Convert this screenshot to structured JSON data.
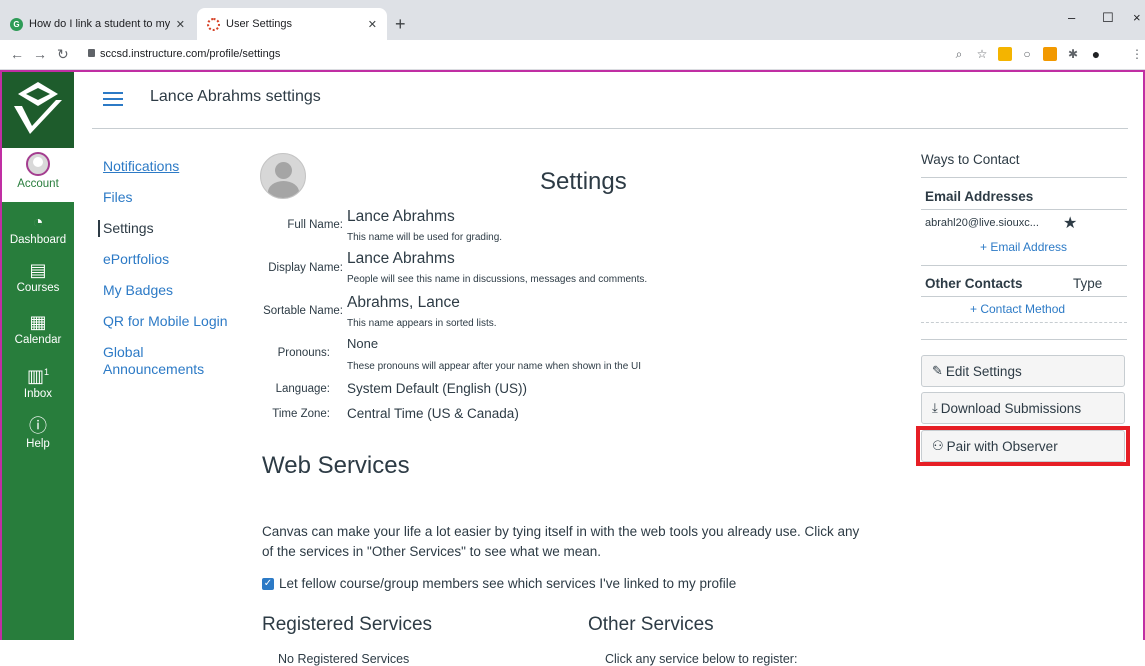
{
  "browser": {
    "tabs": [
      {
        "label": "How do I link a student to my us",
        "active": false
      },
      {
        "label": "User Settings",
        "active": true
      }
    ],
    "new_tab": "+",
    "url": "sccsd.instructure.com/profile/settings",
    "window_controls": {
      "minimize": "–",
      "maximize": "☐",
      "close": "×"
    }
  },
  "global_nav": {
    "items": [
      {
        "label": "Account",
        "icon": "user-avatar-icon"
      },
      {
        "label": "Dashboard",
        "icon": "dashboard-icon"
      },
      {
        "label": "Courses",
        "icon": "courses-icon"
      },
      {
        "label": "Calendar",
        "icon": "calendar-icon"
      },
      {
        "label": "Inbox",
        "icon": "inbox-icon",
        "badge": "1"
      },
      {
        "label": "Help",
        "icon": "help-icon"
      }
    ]
  },
  "header": {
    "name": "Lance Abrahms",
    "suffix": "settings"
  },
  "section_nav": [
    {
      "label": "Notifications"
    },
    {
      "label": "Files"
    },
    {
      "label": "Settings"
    },
    {
      "label": "ePortfolios"
    },
    {
      "label": "My Badges"
    },
    {
      "label": "QR for Mobile Login"
    },
    {
      "label": "Global\nAnnouncements"
    }
  ],
  "settings": {
    "title": "Settings",
    "fields": [
      {
        "label": "Full Name:",
        "value": "Lance Abrahms",
        "hint": "This name will be used for grading."
      },
      {
        "label": "Display Name:",
        "value": "Lance Abrahms",
        "hint": "People will see this name in discussions, messages and comments."
      },
      {
        "label": "Sortable Name:",
        "value": "Abrahms, Lance",
        "hint": "This name appears in sorted lists."
      },
      {
        "label": "Pronouns:",
        "value": "None",
        "hint": "These pronouns will appear after your name when shown in the UI"
      },
      {
        "label": "Language:",
        "value": "System Default (English (US))"
      },
      {
        "label": "Time Zone:",
        "value": "Central Time (US & Canada)"
      }
    ]
  },
  "web_services": {
    "title": "Web Services",
    "description": "Canvas can make your life a lot easier by tying itself in with the web tools you already use. Click any of the services in \"Other Services\" to see what we mean.",
    "checkbox_label": "Let fellow course/group members see which services I've linked to my profile",
    "registered_title": "Registered Services",
    "registered_empty": "No Registered Services",
    "other_title": "Other Services",
    "other_hint": "Click any service below to register:"
  },
  "sidebar": {
    "ways_to_contact": "Ways to Contact",
    "email_header": "Email Addresses",
    "email": "abrahl20@live.siouxc...",
    "add_email": "+ Email Address",
    "other_contacts": "Other Contacts",
    "type_header": "Type",
    "add_contact": "+ Contact Method",
    "buttons": {
      "edit": "Edit Settings",
      "download": "Download Submissions",
      "pair": "Pair with Observer"
    }
  },
  "colors": {
    "nav_green": "#287d3c",
    "link_blue": "#2c7ac6",
    "highlight_red": "#e61e25",
    "frame_magenta": "#c02ea3"
  }
}
